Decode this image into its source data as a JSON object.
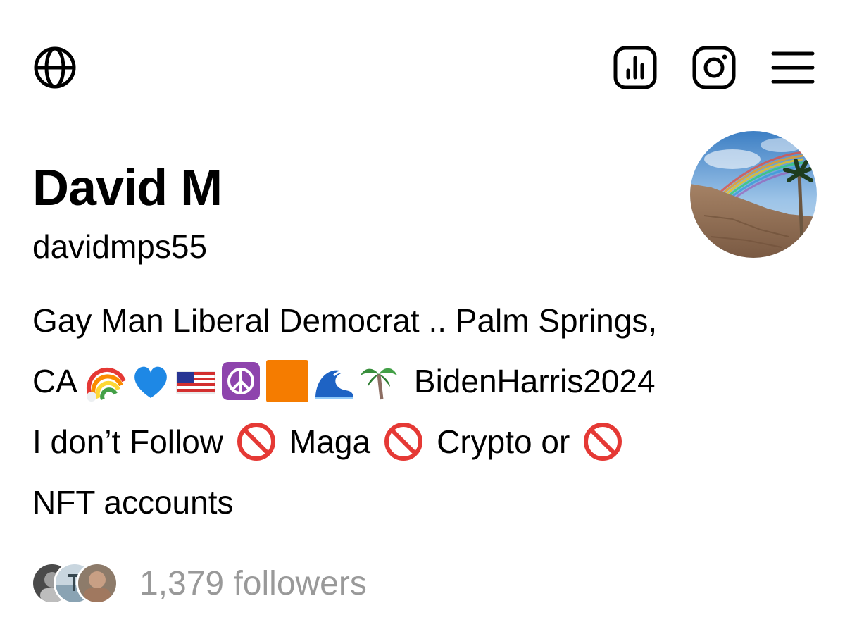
{
  "topbar": {
    "left_icon": "globe-icon",
    "right_icons": [
      "insights-icon",
      "instagram-icon",
      "menu-icon"
    ]
  },
  "profile": {
    "display_name": "David M",
    "username": "davidmps55",
    "avatar_icon": "rainbow-palm-avatar",
    "bio": {
      "line1": "Gay Man Liberal Democrat .. Palm Springs,",
      "line2_start": "CA",
      "line2_emojis": [
        "rainbow",
        "blue-heart",
        "us-flag",
        "peace-symbol",
        "orange-square",
        "wave",
        "palm-tree"
      ],
      "line2_end": "BidenHarris2024",
      "line3_a": "I don’t Follow",
      "line3_b": "Maga",
      "line3_c": "Crypto or",
      "line4": "NFT accounts"
    }
  },
  "followers": {
    "count_text": "1,379 followers",
    "avatar_icons": [
      "follower-avatar-1",
      "follower-avatar-2",
      "follower-avatar-3"
    ]
  },
  "colors": {
    "text": "#000000",
    "muted": "#999999",
    "background": "#ffffff"
  }
}
